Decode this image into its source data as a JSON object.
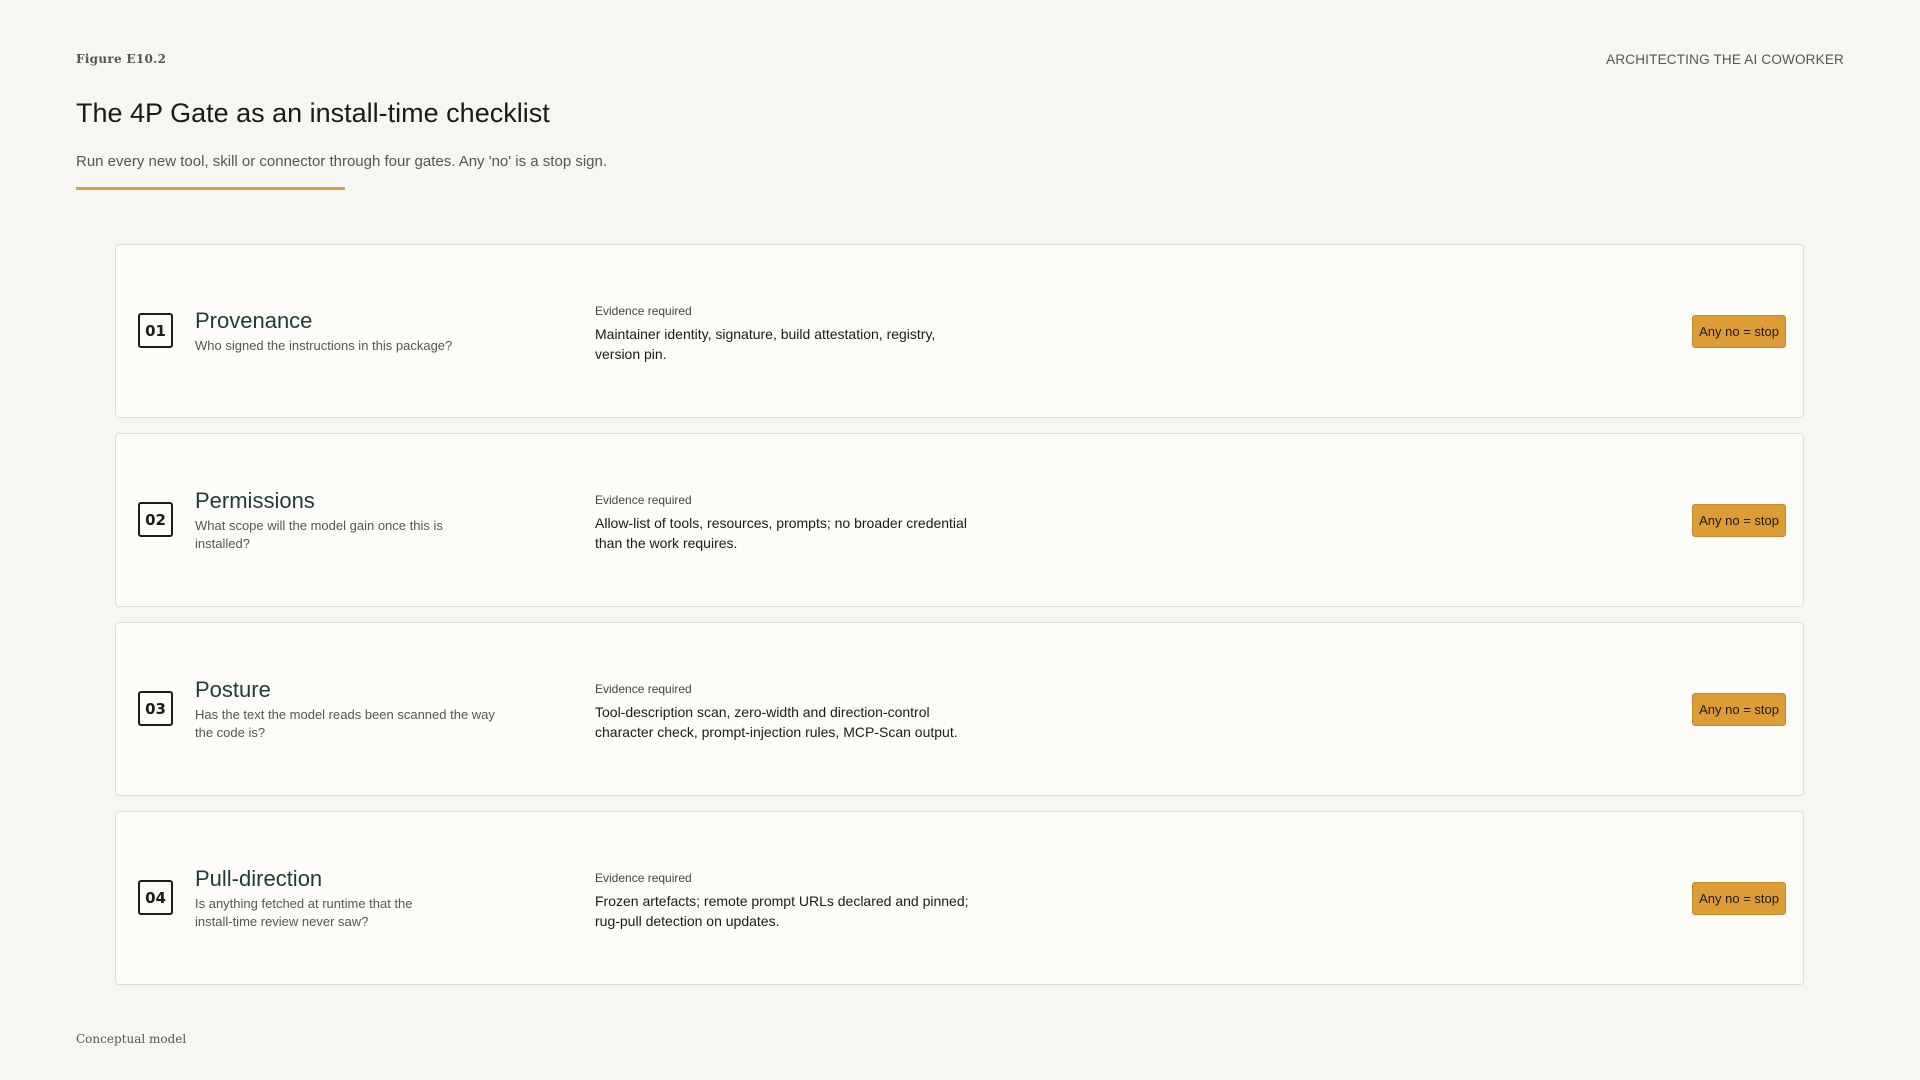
{
  "header": {
    "figure_label": "Figure E10.2",
    "book_title": "ARCHITECTING THE AI COWORKER",
    "title": "The 4P Gate as an install-time checklist",
    "subtitle": "Run every new tool, skill or connector through four gates. Any 'no' is a stop sign."
  },
  "colors": {
    "accent": "#d9a040",
    "badge": "#dd9d36",
    "background": "#f8f6f2",
    "card": "#fdfcf8",
    "gate_name": "#1f3a3a"
  },
  "gates": [
    {
      "number": "01",
      "name": "Provenance",
      "question": "Who signed the instructions in this package?",
      "evidence_label": "Evidence required",
      "evidence": "Maintainer identity, signature, build attestation, registry, version pin.",
      "badge": "Any no = stop"
    },
    {
      "number": "02",
      "name": "Permissions",
      "question": "What scope will the model gain once this is installed?",
      "evidence_label": "Evidence required",
      "evidence": "Allow-list of tools, resources, prompts; no broader credential than the work requires.",
      "badge": "Any no = stop"
    },
    {
      "number": "03",
      "name": "Posture",
      "question": "Has the text the model reads been scanned the way the code is?",
      "evidence_label": "Evidence required",
      "evidence": "Tool-description scan, zero-width and direction-control character check, prompt-injection rules, MCP-Scan output.",
      "badge": "Any no = stop"
    },
    {
      "number": "04",
      "name": "Pull-direction",
      "question": "Is anything fetched at runtime that the install-time review never saw?",
      "evidence_label": "Evidence required",
      "evidence": "Frozen artefacts; remote prompt URLs declared and pinned; rug-pull detection on updates.",
      "badge": "Any no = stop"
    }
  ],
  "footer": {
    "note": "Conceptual model"
  }
}
